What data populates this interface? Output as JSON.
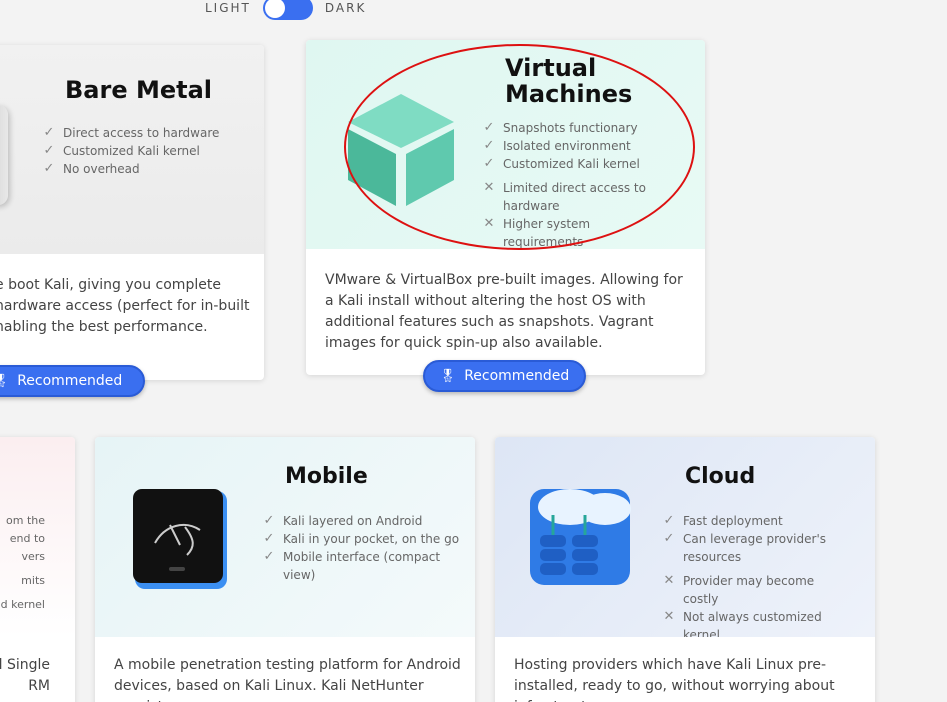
{
  "theme_toggle": {
    "light_label": "LIGHT",
    "dark_label": "DARK"
  },
  "cards": {
    "bare_metal": {
      "title": "Bare Metal",
      "features": [
        {
          "type": "check",
          "text": "Direct access to hardware"
        },
        {
          "type": "check",
          "text": "Customized Kali kernel"
        },
        {
          "type": "check",
          "text": "No overhead"
        }
      ],
      "description": "e boot Kali, giving you complete hardware access (perfect for in-built nabling the best performance.",
      "button": "Recommended"
    },
    "virtual_machines": {
      "title": "Virtual Machines",
      "features": [
        {
          "type": "check",
          "text": "Snapshots functionary"
        },
        {
          "type": "check",
          "text": "Isolated environment"
        },
        {
          "type": "check",
          "text": "Customized Kali kernel"
        },
        {
          "type": "cross",
          "text": "Limited direct access to hardware"
        },
        {
          "type": "cross",
          "text": "Higher system requirements"
        }
      ],
      "description": "VMware & VirtualBox pre-built images. Allowing for a Kali install without altering the host OS with additional features such as snapshots. Vagrant images for quick spin-up also available.",
      "button": "Recommended"
    },
    "partial_left": {
      "features": [
        {
          "text": "om the"
        },
        {
          "text": "end to"
        },
        {
          "text": "vers"
        },
        {
          "text": "mits"
        },
        {
          "text": "d kernel"
        }
      ],
      "description_lines": [
        "d Single",
        "RM"
      ]
    },
    "mobile": {
      "title": "Mobile",
      "features": [
        {
          "type": "check",
          "text": "Kali layered on Android"
        },
        {
          "type": "check",
          "text": "Kali in your pocket, on the go"
        },
        {
          "type": "check",
          "text": "Mobile interface (compact view)"
        }
      ],
      "description": "A mobile penetration testing platform for Android devices, based on Kali Linux. Kali NetHunter consists"
    },
    "cloud": {
      "title": "Cloud",
      "features": [
        {
          "type": "check",
          "text": "Fast deployment"
        },
        {
          "type": "check",
          "text": "Can leverage provider's resources"
        },
        {
          "type": "cross",
          "text": "Provider may become costly"
        },
        {
          "type": "cross",
          "text": "Not always customized kernel"
        }
      ],
      "description": "Hosting providers which have Kali Linux pre-installed, ready to go, without worrying about infrastructure"
    }
  },
  "colors": {
    "accent": "#3a6ff0",
    "highlight": "#dd1111",
    "vm_bg": "#dff7f1",
    "cube": "#5fc9ae"
  }
}
